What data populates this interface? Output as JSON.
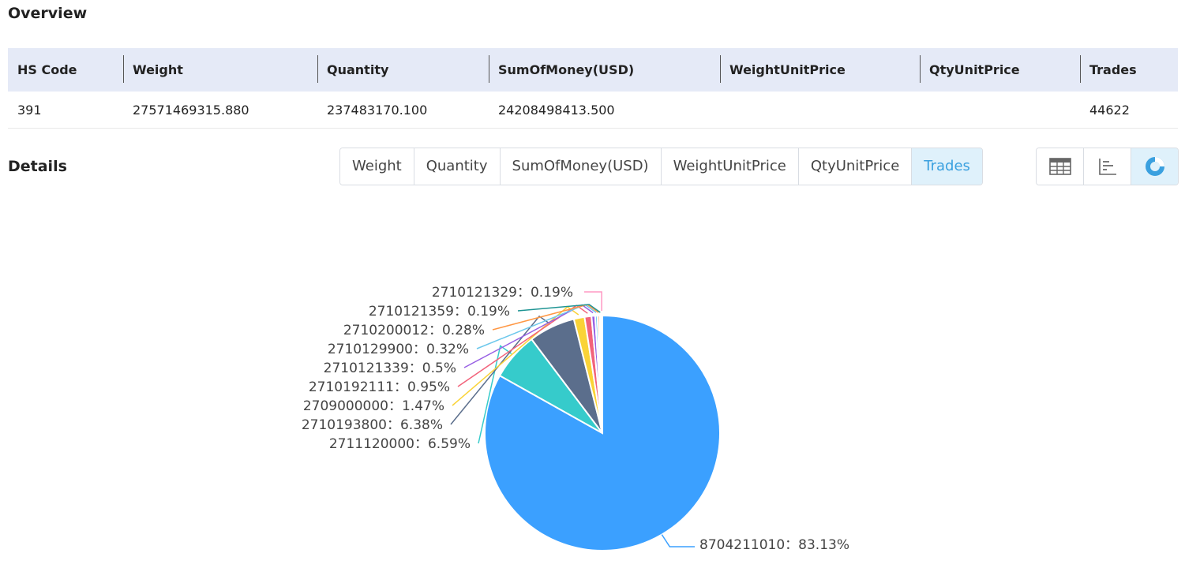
{
  "overview": {
    "title": "Overview",
    "columns": [
      "HS Code",
      "Weight",
      "Quantity",
      "SumOfMoney(USD)",
      "WeightUnitPrice",
      "QtyUnitPrice",
      "Trades"
    ],
    "row": [
      "391",
      "27571469315.880",
      "237483170.100",
      "24208498413.500",
      "",
      "",
      "44622"
    ]
  },
  "details": {
    "title": "Details",
    "tabs": [
      "Weight",
      "Quantity",
      "SumOfMoney(USD)",
      "WeightUnitPrice",
      "QtyUnitPrice",
      "Trades"
    ],
    "active_tab": "Trades",
    "views": [
      "table-icon",
      "bar-chart-icon",
      "pie-chart-icon"
    ],
    "active_view": "pie-chart-icon",
    "accent_color": "#3aa0df"
  },
  "chart_data": {
    "type": "pie",
    "legend": "none",
    "slices": [
      {
        "label": "8704211010",
        "value": 83.13,
        "display": "8704211010：83.13%",
        "color": "#3ba0ff"
      },
      {
        "label": "2711120000",
        "value": 6.59,
        "display": "2711120000：6.59%",
        "color": "#36cbcb"
      },
      {
        "label": "2710193800",
        "value": 6.38,
        "display": "2710193800：6.38%",
        "color": "#5b6e8c"
      },
      {
        "label": "2709000000",
        "value": 1.47,
        "display": "2709000000：1.47%",
        "color": "#fad337"
      },
      {
        "label": "2710192111",
        "value": 0.95,
        "display": "2710192111：0.95%",
        "color": "#f2637b"
      },
      {
        "label": "2710121339",
        "value": 0.5,
        "display": "2710121339：0.5%",
        "color": "#975fe4"
      },
      {
        "label": "2710129900",
        "value": 0.32,
        "display": "2710129900：0.32%",
        "color": "#6dc8ec"
      },
      {
        "label": "2710200012",
        "value": 0.28,
        "display": "2710200012：0.28%",
        "color": "#ff9845"
      },
      {
        "label": "2710121359",
        "value": 0.19,
        "display": "2710121359：0.19%",
        "color": "#1e9493"
      },
      {
        "label": "2710121329",
        "value": 0.19,
        "display": "2710121329：0.19%",
        "color": "#ff99c3"
      }
    ]
  }
}
